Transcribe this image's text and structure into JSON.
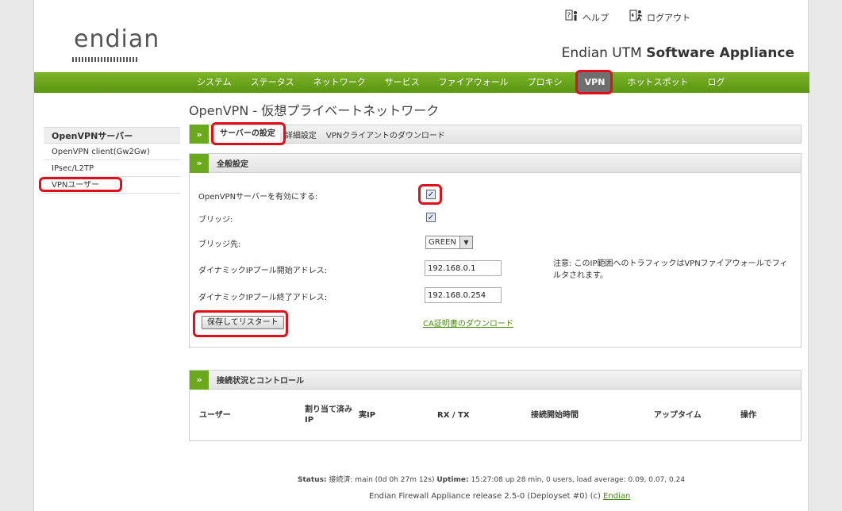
{
  "header": {
    "logo_text": "endian",
    "help_label": "ヘルプ",
    "logout_label": "ログアウト",
    "product_name_prefix": "Endian UTM ",
    "product_name_bold": "Software Appliance"
  },
  "nav": {
    "items": [
      "システム",
      "ステータス",
      "ネットワーク",
      "サービス",
      "ファイアウォール",
      "プロキシ",
      "VPN",
      "ホットスポット",
      "ログ"
    ],
    "active": "VPN"
  },
  "sidebar": {
    "items": [
      "OpenVPNサーバー",
      "OpenVPN client(Gw2Gw)",
      "IPsec/L2TP",
      "VPNユーザー"
    ]
  },
  "main": {
    "title": "OpenVPN - 仮想プライベートネットワーク",
    "tabs": [
      "サーバーの設定",
      "詳細設定",
      "VPNクライアントのダウンロード"
    ],
    "general": {
      "title": "全般設定",
      "enable_label": "OpenVPNサーバーを有効にする:",
      "enable_checked": true,
      "bridge_label": "ブリッジ:",
      "bridge_checked": true,
      "bridge_to_label": "ブリッジ先:",
      "bridge_to_value": "GREEN",
      "pool_start_label": "ダイナミックIPプール開始アドレス:",
      "pool_start_value": "192.168.0.1",
      "pool_end_label": "ダイナミックIPプール終了アドレス:",
      "pool_end_value": "192.168.0.254",
      "note": "注意: このIP範囲へのトラフィックはVPNファイアウォールでフィルタされます。",
      "save_button": "保存してリスタート",
      "ca_link": "CA証明書のダウンロード"
    },
    "connections": {
      "title": "接続状況とコントロール",
      "columns": [
        "ユーザー",
        "割り当て済みIP",
        "実IP",
        "RX / TX",
        "接続開始時間",
        "アップタイム",
        "操作"
      ]
    }
  },
  "footer": {
    "status_label": "Status:",
    "status_value": "接続済: main (0d 0h 27m 12s)",
    "uptime_label": "Uptime:",
    "uptime_value": "15:27:08 up 28 min, 0 users, load average: 0.09, 0.07, 0.24",
    "release_text": "Endian Firewall Appliance release 2.5-0 (Deployset #0) (c) ",
    "release_link": "Endian"
  }
}
